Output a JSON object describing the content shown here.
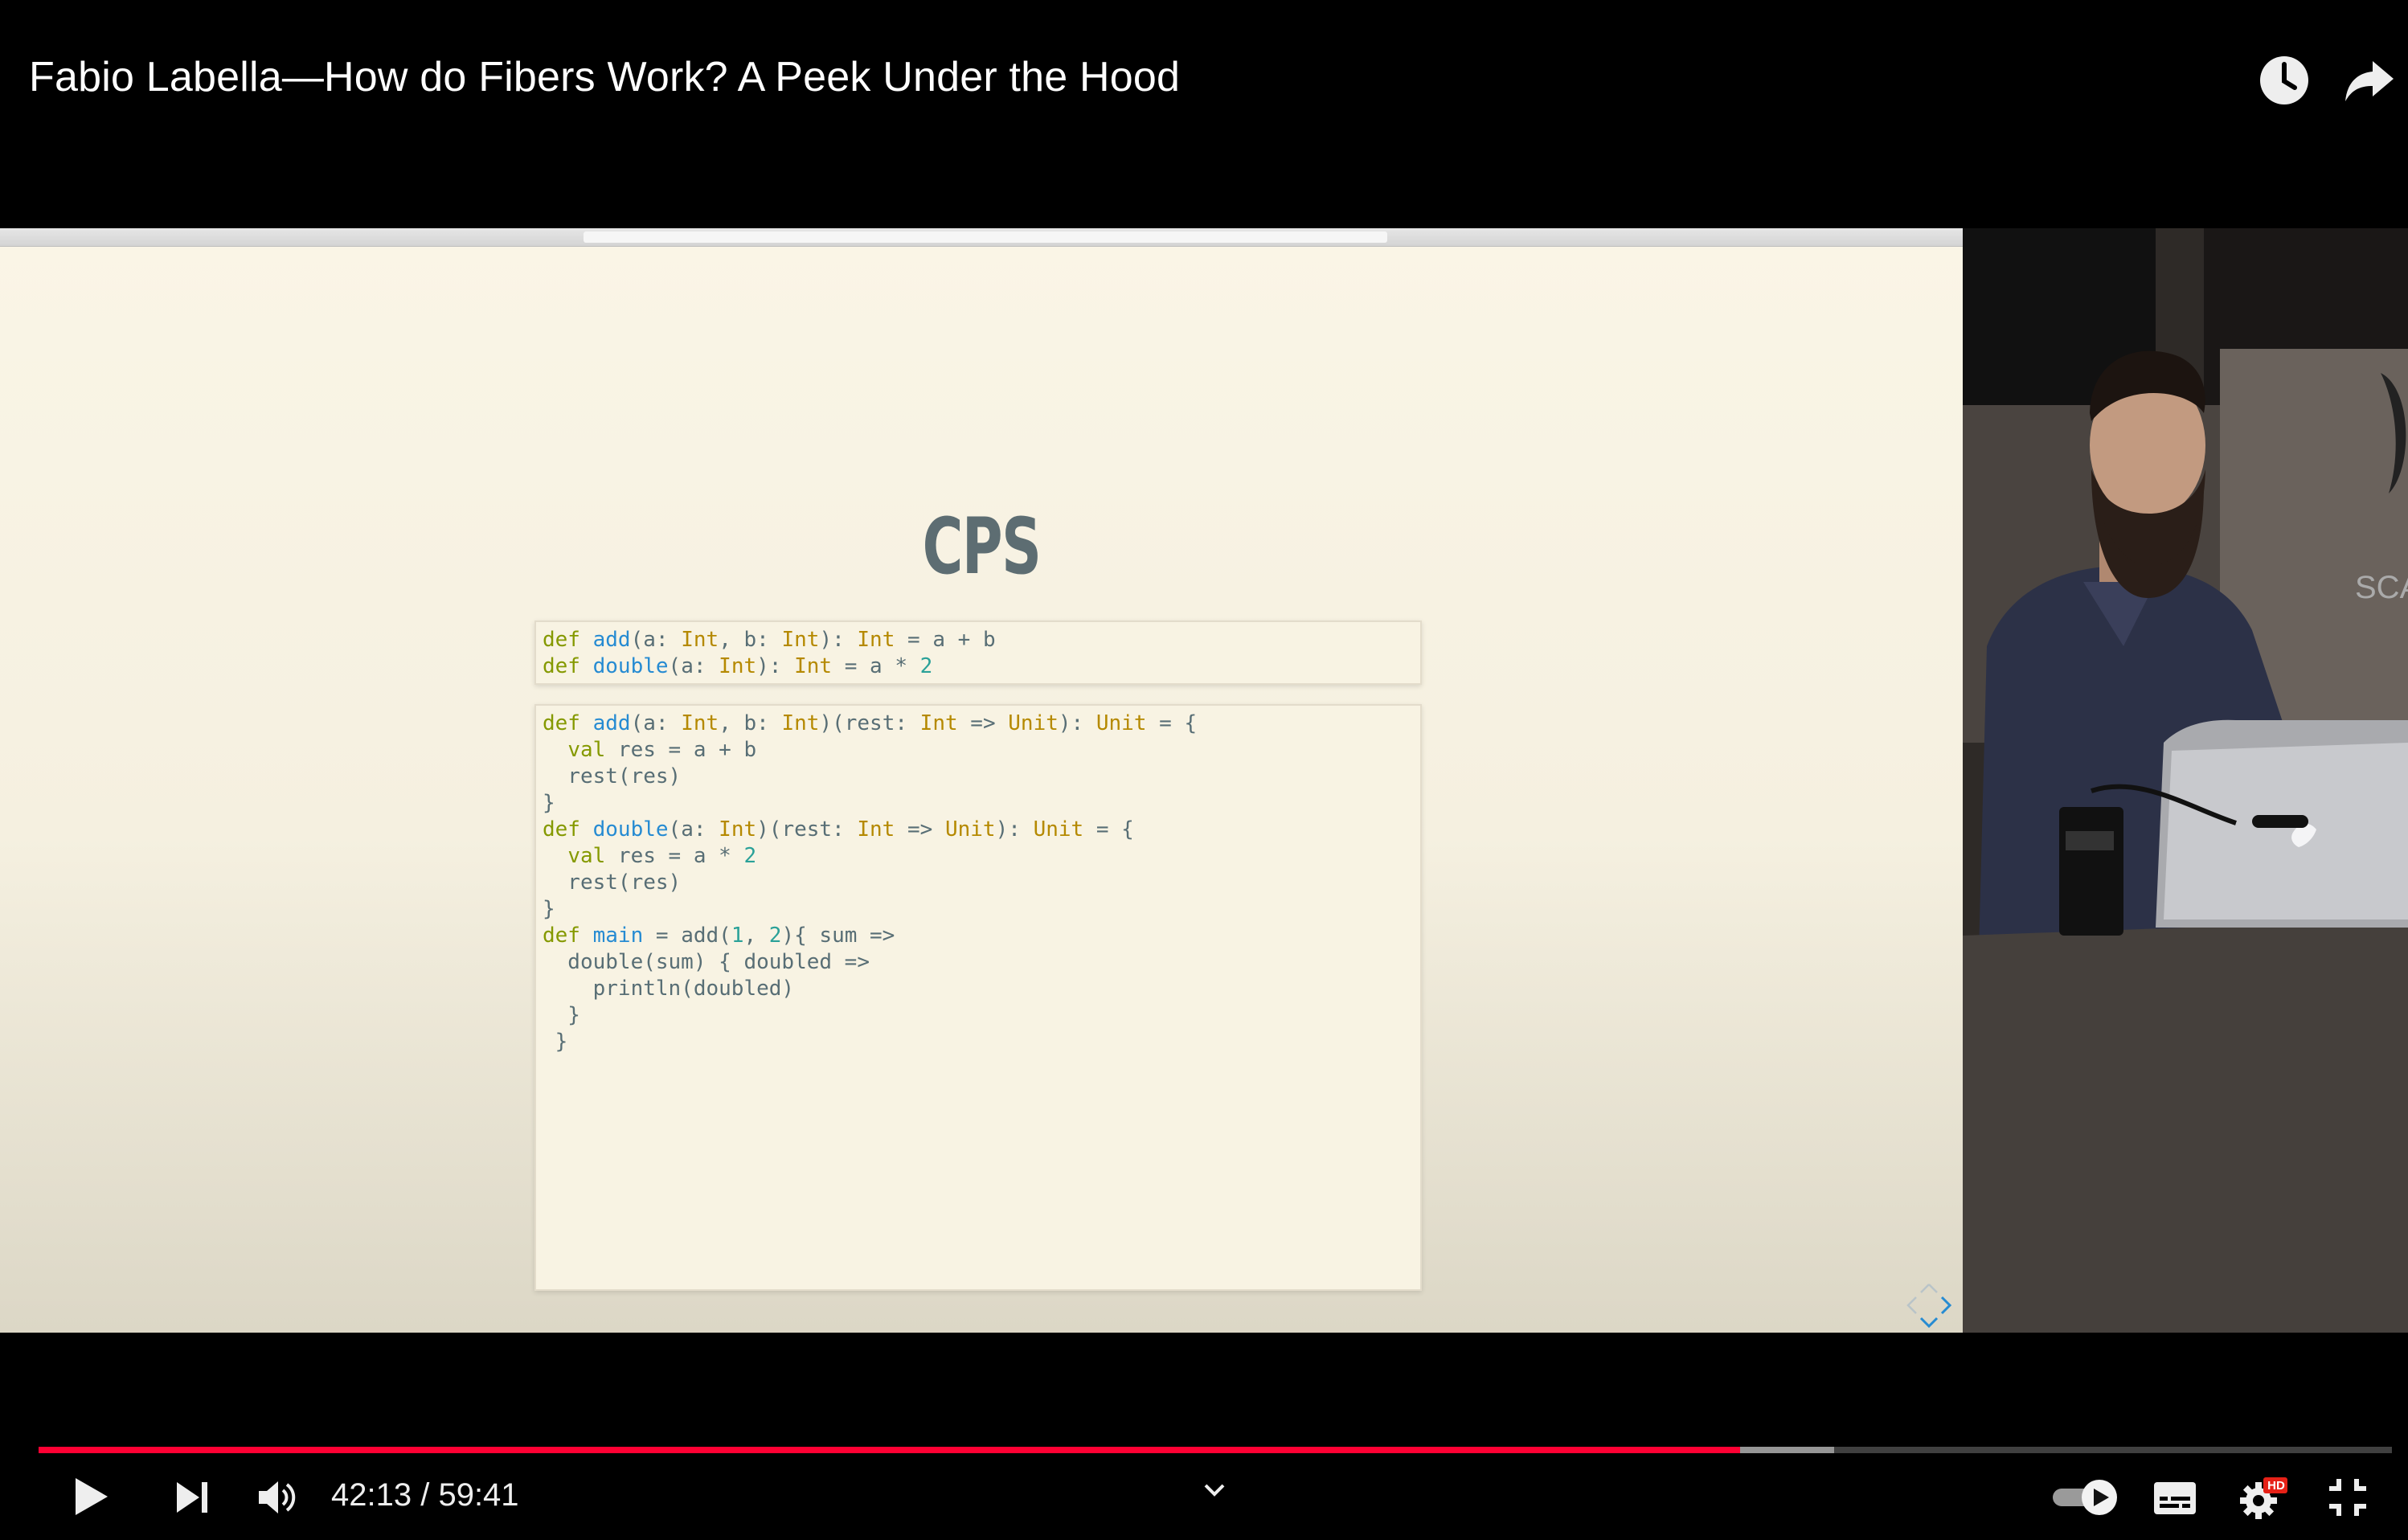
{
  "video": {
    "title": "Fabio Labella—How do Fibers Work? A Peek Under the Hood"
  },
  "slide": {
    "heading": "CPS",
    "code_block_1": [
      [
        [
          "kw",
          "def "
        ],
        [
          "fn",
          "add"
        ],
        [
          "t",
          "(a: "
        ],
        [
          "ty",
          "Int"
        ],
        [
          "t",
          ", b: "
        ],
        [
          "ty",
          "Int"
        ],
        [
          "t",
          "): "
        ],
        [
          "ty",
          "Int"
        ],
        [
          "t",
          " = a + b"
        ]
      ],
      [
        [
          "kw",
          "def "
        ],
        [
          "fn",
          "double"
        ],
        [
          "t",
          "(a: "
        ],
        [
          "ty",
          "Int"
        ],
        [
          "t",
          "): "
        ],
        [
          "ty",
          "Int"
        ],
        [
          "t",
          " = a * "
        ],
        [
          "nu",
          "2"
        ]
      ]
    ],
    "code_block_2": [
      [
        [
          "kw",
          "def "
        ],
        [
          "fn",
          "add"
        ],
        [
          "t",
          "(a: "
        ],
        [
          "ty",
          "Int"
        ],
        [
          "t",
          ", b: "
        ],
        [
          "ty",
          "Int"
        ],
        [
          "t",
          ")(rest: "
        ],
        [
          "ty",
          "Int"
        ],
        [
          "t",
          " => "
        ],
        [
          "ty",
          "Unit"
        ],
        [
          "t",
          "): "
        ],
        [
          "ty",
          "Unit"
        ],
        [
          "t",
          " = {"
        ]
      ],
      [
        [
          "t",
          "  "
        ],
        [
          "kw",
          "val"
        ],
        [
          "t",
          " res = a + b"
        ]
      ],
      [
        [
          "t",
          "  rest(res)"
        ]
      ],
      [
        [
          "t",
          "}"
        ]
      ],
      [
        [
          "kw",
          "def "
        ],
        [
          "fn",
          "double"
        ],
        [
          "t",
          "(a: "
        ],
        [
          "ty",
          "Int"
        ],
        [
          "t",
          ")(rest: "
        ],
        [
          "ty",
          "Int"
        ],
        [
          "t",
          " => "
        ],
        [
          "ty",
          "Unit"
        ],
        [
          "t",
          "): "
        ],
        [
          "ty",
          "Unit"
        ],
        [
          "t",
          " = {"
        ]
      ],
      [
        [
          "t",
          "  "
        ],
        [
          "kw",
          "val"
        ],
        [
          "t",
          " res = a * "
        ],
        [
          "nu",
          "2"
        ]
      ],
      [
        [
          "t",
          "  rest(res)"
        ]
      ],
      [
        [
          "t",
          "}"
        ]
      ],
      [
        [
          "kw",
          "def "
        ],
        [
          "fn",
          "main"
        ],
        [
          "t",
          " = add("
        ],
        [
          "nu",
          "1"
        ],
        [
          "t",
          ", "
        ],
        [
          "nu",
          "2"
        ],
        [
          "t",
          "){ sum =>"
        ]
      ],
      [
        [
          "t",
          "  double(sum) { doubled =>"
        ]
      ],
      [
        [
          "t",
          "    println(doubled)"
        ]
      ],
      [
        [
          "t",
          "  }"
        ]
      ],
      [
        [
          "t",
          " }"
        ]
      ]
    ]
  },
  "player": {
    "current_time": "42:13",
    "time_separator": " / ",
    "duration": "59:41",
    "played_fraction": 0.723,
    "buffered_fraction": 0.763,
    "quality_badge": "HD",
    "progress_color": "#ff0033"
  },
  "icons": {
    "watch_later": "clock-icon",
    "share": "share-arrow-icon",
    "play": "play-icon",
    "next": "next-icon",
    "volume": "volume-icon",
    "chapters": "chevron-down-icon",
    "autoplay": "autoplay-toggle-icon",
    "captions": "subtitles-icon",
    "settings": "gear-icon",
    "exit_fullscreen": "exit-fullscreen-icon"
  }
}
